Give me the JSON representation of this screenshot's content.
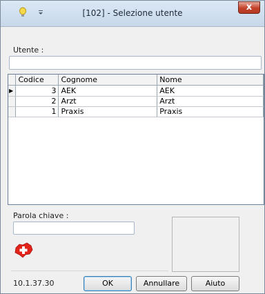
{
  "window": {
    "title": "[102] - Selezione utente",
    "close_label": "x"
  },
  "user": {
    "label": "Utente :",
    "value": ""
  },
  "grid": {
    "columns": [
      "Codice",
      "Cognome",
      "Nome"
    ],
    "rows": [
      {
        "codice": "3",
        "cognome": "AEK",
        "nome": "AEK",
        "current": true
      },
      {
        "codice": "2",
        "cognome": "Arzt",
        "nome": "Arzt",
        "current": false
      },
      {
        "codice": "1",
        "cognome": "Praxis",
        "nome": "Praxis",
        "current": false
      }
    ]
  },
  "keyword": {
    "label": "Parola chiave :",
    "value": ""
  },
  "footer": {
    "version": "10.1.37.30",
    "ok_label": "OK",
    "cancel_label": "Annullare",
    "help_label": "Aiuto"
  },
  "icons": {
    "logo": "swiss-cross-logo-icon",
    "bulb": "lightbulb-icon",
    "qat": "quick-access-menu-icon"
  },
  "colors": {
    "logo_red": "#e2231a",
    "close_red": "#c4412a"
  }
}
